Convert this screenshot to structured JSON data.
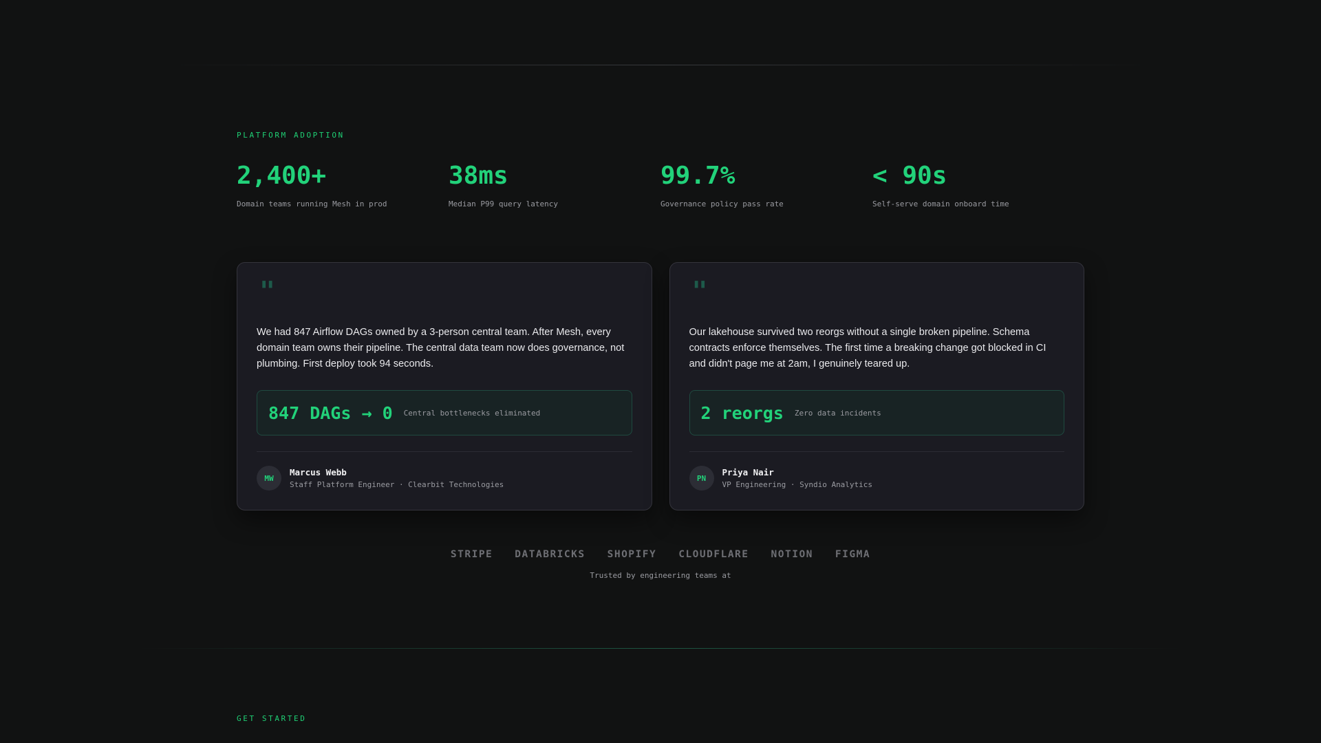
{
  "adoption": {
    "eyebrow": "PLATFORM ADOPTION",
    "stats": [
      {
        "value": "2,400+",
        "label": "Domain teams running Mesh in prod"
      },
      {
        "value": "38ms",
        "label": "Median P99 query latency"
      },
      {
        "value": "99.7%",
        "label": "Governance policy pass rate"
      },
      {
        "value": "< 90s",
        "label": "Self-serve domain onboard time"
      }
    ]
  },
  "testimonials": [
    {
      "quote_mark": "\"",
      "quote": "We had 847 Airflow DAGs owned by a 3-person central team. After Mesh, every domain team owns their pipeline. The central data team now does governance, not plumbing. First deploy took 94 seconds.",
      "metric_value": "847 DAGs → 0",
      "metric_label": "Central bottlenecks eliminated",
      "initials": "MW",
      "name": "Marcus Webb",
      "role": "Staff Platform Engineer · Clearbit Technologies"
    },
    {
      "quote_mark": "\"",
      "quote": "Our lakehouse survived two reorgs without a single broken pipeline. Schema contracts enforce themselves. The first time a breaking change got blocked in CI and didn't page me at 2am, I genuinely teared up.",
      "metric_value": "2 reorgs",
      "metric_label": "Zero data incidents",
      "initials": "PN",
      "name": "Priya Nair",
      "role": "VP Engineering · Syndio Analytics"
    }
  ],
  "logos": {
    "items": [
      "STRIPE",
      "DATABRICKS",
      "SHOPIFY",
      "CLOUDFLARE",
      "NOTION",
      "FIGMA"
    ],
    "caption": "Trusted by engineering teams at"
  },
  "get_started": {
    "eyebrow": "GET STARTED"
  },
  "colors": {
    "accent": "#22d27a",
    "background": "#111212",
    "card": "#1b1b22"
  }
}
